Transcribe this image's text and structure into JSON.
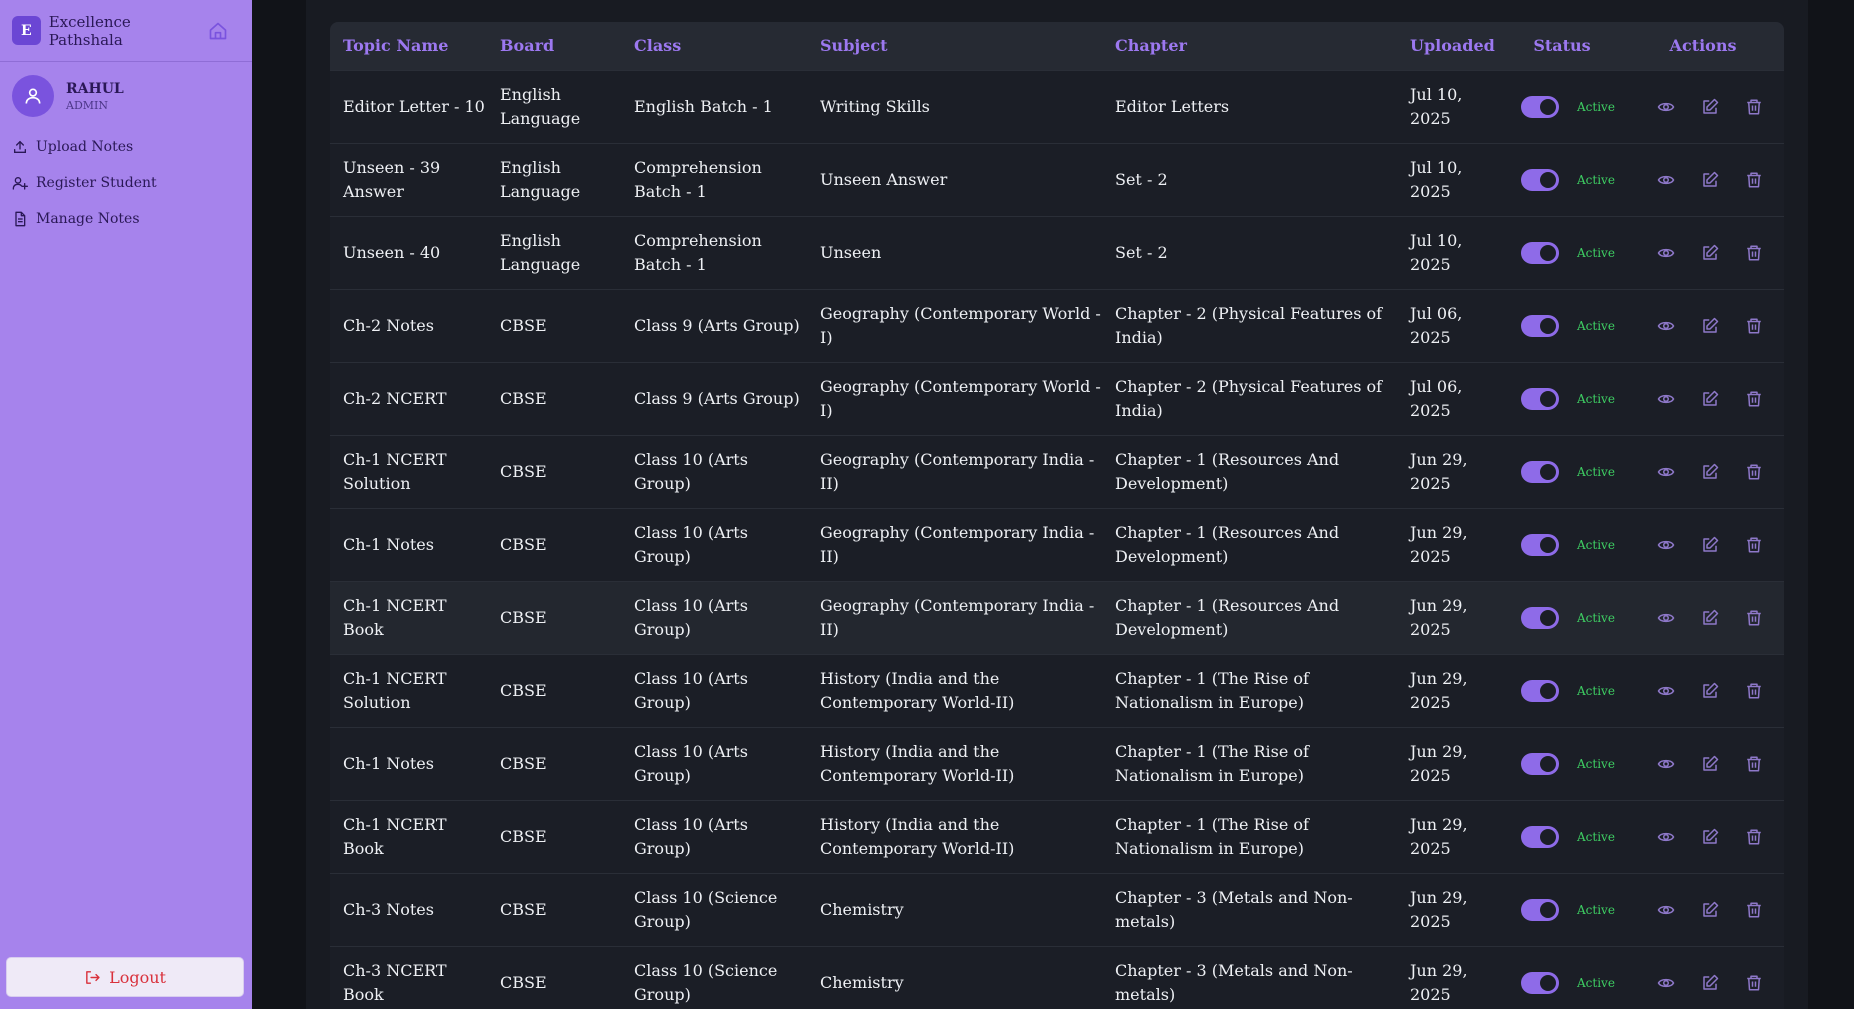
{
  "brand": {
    "logo_letter": "E",
    "name": "Excellence Pathshala"
  },
  "user": {
    "name": "RAHUL",
    "role": "ADMIN"
  },
  "nav": [
    {
      "label": "Upload Notes",
      "icon": "upload-icon"
    },
    {
      "label": "Register Student",
      "icon": "user-plus-icon"
    },
    {
      "label": "Manage Notes",
      "icon": "document-icon"
    }
  ],
  "logout_label": "Logout",
  "columns": [
    "Topic Name",
    "Board",
    "Class",
    "Subject",
    "Chapter",
    "Uploaded",
    "Status",
    "Actions"
  ],
  "rows": [
    {
      "topic": "Editor Letter - 10",
      "board": "English Language",
      "class": "English Batch - 1",
      "subject": "Writing Skills",
      "chapter": "Editor Letters",
      "uploaded": "Jul 10, 2025",
      "status": "Active"
    },
    {
      "topic": "Unseen - 39 Answer",
      "board": "English Language",
      "class": "Comprehension Batch - 1",
      "subject": "Unseen Answer",
      "chapter": "Set - 2",
      "uploaded": "Jul 10, 2025",
      "status": "Active"
    },
    {
      "topic": "Unseen - 40",
      "board": "English Language",
      "class": "Comprehension Batch - 1",
      "subject": "Unseen",
      "chapter": "Set - 2",
      "uploaded": "Jul 10, 2025",
      "status": "Active"
    },
    {
      "topic": "Ch-2 Notes",
      "board": "CBSE",
      "class": "Class 9 (Arts Group)",
      "subject": "Geography (Contemporary World - I)",
      "chapter": "Chapter - 2 (Physical Features of India)",
      "uploaded": "Jul 06, 2025",
      "status": "Active"
    },
    {
      "topic": "Ch-2 NCERT",
      "board": "CBSE",
      "class": "Class 9 (Arts Group)",
      "subject": "Geography (Contemporary World - I)",
      "chapter": "Chapter - 2 (Physical Features of India)",
      "uploaded": "Jul 06, 2025",
      "status": "Active"
    },
    {
      "topic": "Ch-1 NCERT Solution",
      "board": "CBSE",
      "class": "Class 10 (Arts Group)",
      "subject": "Geography (Contemporary India - II)",
      "chapter": "Chapter - 1 (Resources And Development)",
      "uploaded": "Jun 29, 2025",
      "status": "Active"
    },
    {
      "topic": "Ch-1 Notes",
      "board": "CBSE",
      "class": "Class 10 (Arts Group)",
      "subject": "Geography (Contemporary India - II)",
      "chapter": "Chapter - 1 (Resources And Development)",
      "uploaded": "Jun 29, 2025",
      "status": "Active"
    },
    {
      "topic": "Ch-1 NCERT Book",
      "board": "CBSE",
      "class": "Class 10 (Arts Group)",
      "subject": "Geography (Contemporary India - II)",
      "chapter": "Chapter - 1 (Resources And Development)",
      "uploaded": "Jun 29, 2025",
      "status": "Active"
    },
    {
      "topic": "Ch-1 NCERT Solution",
      "board": "CBSE",
      "class": "Class 10 (Arts Group)",
      "subject": "History (India and the Contemporary World-II)",
      "chapter": "Chapter - 1 (The Rise of Nationalism in Europe)",
      "uploaded": "Jun 29, 2025",
      "status": "Active"
    },
    {
      "topic": "Ch-1 Notes",
      "board": "CBSE",
      "class": "Class 10 (Arts Group)",
      "subject": "History (India and the Contemporary World-II)",
      "chapter": "Chapter - 1 (The Rise of Nationalism in Europe)",
      "uploaded": "Jun 29, 2025",
      "status": "Active"
    },
    {
      "topic": "Ch-1 NCERT Book",
      "board": "CBSE",
      "class": "Class 10 (Arts Group)",
      "subject": "History (India and the Contemporary World-II)",
      "chapter": "Chapter - 1 (The Rise of Nationalism in Europe)",
      "uploaded": "Jun 29, 2025",
      "status": "Active"
    },
    {
      "topic": "Ch-3 Notes",
      "board": "CBSE",
      "class": "Class 10 (Science Group)",
      "subject": "Chemistry",
      "chapter": "Chapter - 3 (Metals and Non-metals)",
      "uploaded": "Jun 29, 2025",
      "status": "Active"
    },
    {
      "topic": "Ch-3 NCERT Book",
      "board": "CBSE",
      "class": "Class 10 (Science Group)",
      "subject": "Chemistry",
      "chapter": "Chapter - 3 (Metals and Non-metals)",
      "uploaded": "Jun 29, 2025",
      "status": "Active"
    }
  ],
  "highlighted_row": 7,
  "colors": {
    "sidebar": "#a683ec",
    "accent": "#9c78f0",
    "active": "#3ecf63",
    "danger": "#d9303b",
    "background": "#111318"
  }
}
